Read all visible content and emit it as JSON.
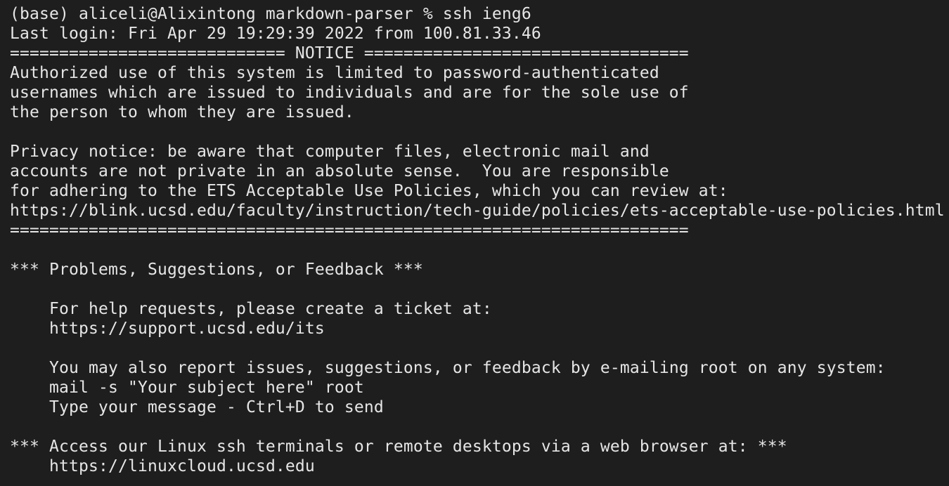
{
  "terminal": {
    "prompt_line": "(base) aliceli@Alixintong markdown-parser % ssh ieng6",
    "last_login": "Last login: Fri Apr 29 19:29:39 2022 from 100.81.33.46",
    "notice_header": "============================ NOTICE =================================",
    "notice_lines": [
      "Authorized use of this system is limited to password-authenticated",
      "usernames which are issued to individuals and are for the sole use of",
      "the person to whom they are issued."
    ],
    "privacy_lines": [
      "Privacy notice: be aware that computer files, electronic mail and",
      "accounts are not private in an absolute sense.  You are responsible",
      "for adhering to the ETS Acceptable Use Policies, which you can review at:",
      "https://blink.ucsd.edu/faculty/instruction/tech-guide/policies/ets-acceptable-use-policies.html"
    ],
    "notice_footer": "=====================================================================",
    "feedback_heading": "*** Problems, Suggestions, or Feedback ***",
    "help_lines": [
      "For help requests, please create a ticket at:",
      "https://support.ucsd.edu/its"
    ],
    "report_lines": [
      "You may also report issues, suggestions, or feedback by e-mailing root on any system:",
      "mail -s \"Your subject here\" root",
      "Type your message - Ctrl+D to send"
    ],
    "access_heading": "*** Access our Linux ssh terminals or remote desktops via a web browser at: ***",
    "access_url": "https://linuxcloud.ucsd.edu"
  },
  "colors": {
    "background": "#1e1e1e",
    "foreground": "#e6e6e6"
  }
}
